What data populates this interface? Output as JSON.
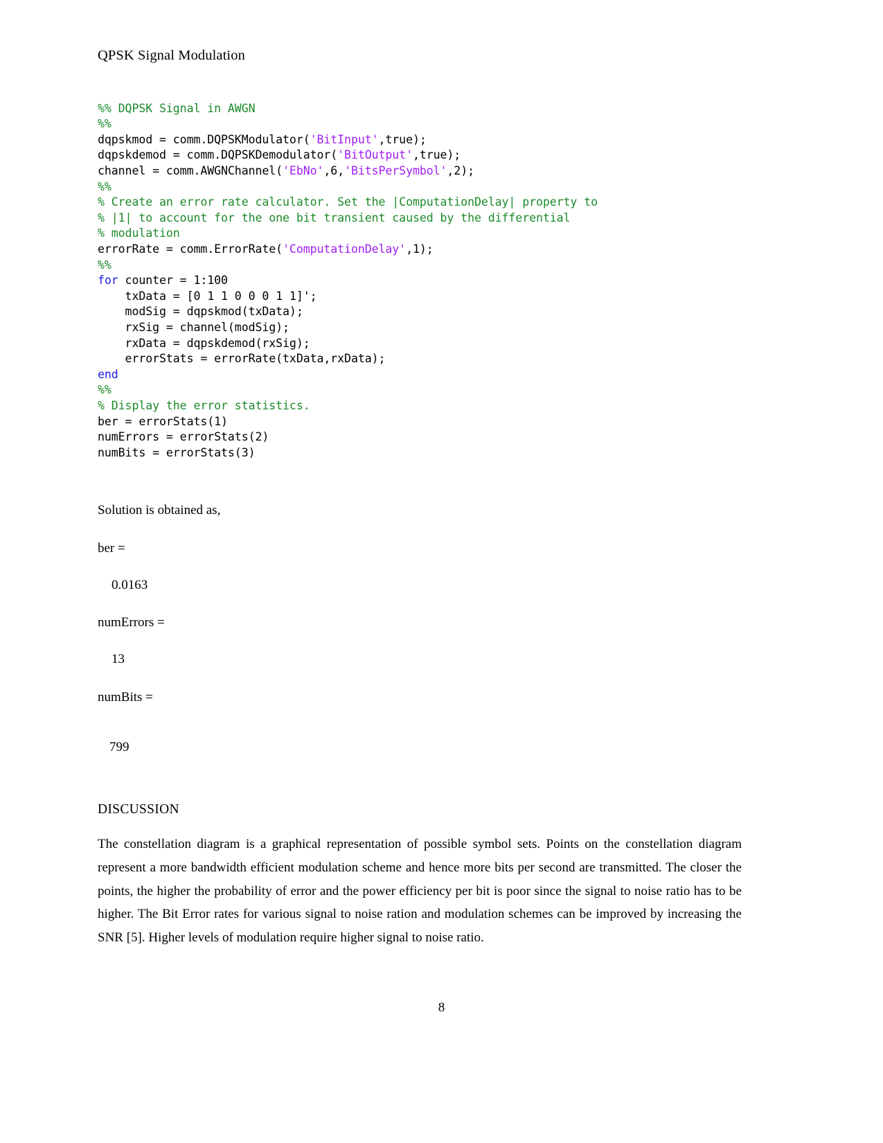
{
  "document": {
    "title": "QPSK Signal Modulation",
    "page_number": "8"
  },
  "code": {
    "language": "matlab",
    "lines": [
      [
        {
          "t": "comment",
          "s": "%% DQPSK Signal in AWGN"
        }
      ],
      [
        {
          "t": "comment",
          "s": "%%"
        }
      ],
      [
        {
          "t": "plain",
          "s": "dqpskmod = comm.DQPSKModulator("
        },
        {
          "t": "string",
          "s": "'BitInput'"
        },
        {
          "t": "plain",
          "s": ",true);"
        }
      ],
      [
        {
          "t": "plain",
          "s": "dqpskdemod = comm.DQPSKDemodulator("
        },
        {
          "t": "string",
          "s": "'BitOutput'"
        },
        {
          "t": "plain",
          "s": ",true);"
        }
      ],
      [
        {
          "t": "plain",
          "s": "channel = comm.AWGNChannel("
        },
        {
          "t": "string",
          "s": "'EbNo'"
        },
        {
          "t": "plain",
          "s": ",6,"
        },
        {
          "t": "string",
          "s": "'BitsPerSymbol'"
        },
        {
          "t": "plain",
          "s": ",2);"
        }
      ],
      [
        {
          "t": "comment",
          "s": "%%"
        }
      ],
      [
        {
          "t": "comment",
          "s": "% Create an error rate calculator. Set the |ComputationDelay| property to"
        }
      ],
      [
        {
          "t": "comment",
          "s": "% |1| to account for the one bit transient caused by the differential"
        }
      ],
      [
        {
          "t": "comment",
          "s": "% modulation"
        }
      ],
      [
        {
          "t": "plain",
          "s": "errorRate = comm.ErrorRate("
        },
        {
          "t": "string",
          "s": "'ComputationDelay'"
        },
        {
          "t": "plain",
          "s": ",1);"
        }
      ],
      [
        {
          "t": "comment",
          "s": "%%"
        }
      ],
      [
        {
          "t": "keyword",
          "s": "for"
        },
        {
          "t": "plain",
          "s": " counter = 1:100"
        }
      ],
      [
        {
          "t": "plain",
          "s": "    txData = [0 1 1 0 0 0 1 1]';"
        }
      ],
      [
        {
          "t": "plain",
          "s": "    modSig = dqpskmod(txData);"
        }
      ],
      [
        {
          "t": "plain",
          "s": "    rxSig = channel(modSig);"
        }
      ],
      [
        {
          "t": "plain",
          "s": "    rxData = dqpskdemod(rxSig);"
        }
      ],
      [
        {
          "t": "plain",
          "s": "    errorStats = errorRate(txData,rxData);"
        }
      ],
      [
        {
          "t": "keyword",
          "s": "end"
        }
      ],
      [
        {
          "t": "comment",
          "s": "%%"
        }
      ],
      [
        {
          "t": "comment",
          "s": "% Display the error statistics."
        }
      ],
      [
        {
          "t": "plain",
          "s": "ber = errorStats(1)"
        }
      ],
      [
        {
          "t": "plain",
          "s": "numErrors = errorStats(2)"
        }
      ],
      [
        {
          "t": "plain",
          "s": "numBits = errorStats(3)"
        }
      ]
    ]
  },
  "results": {
    "lead_in": "Solution is obtained as,",
    "items": [
      {
        "label": "ber =",
        "value": "0.0163"
      },
      {
        "label": "numErrors =",
        "value": "13"
      },
      {
        "label": "numBits =",
        "value": "799"
      }
    ]
  },
  "discussion": {
    "heading": "DISCUSSION",
    "paragraph": "The constellation diagram is a graphical representation of possible symbol sets. Points on the constellation diagram represent a more bandwidth efficient modulation scheme and hence more bits per second are transmitted. The closer the points, the higher the probability of error and the power efficiency per bit is poor since the signal to noise ratio has to be higher. The Bit Error rates for various signal to noise ration and modulation schemes can be improved by increasing the SNR [5]. Higher levels of modulation require higher signal to noise ratio."
  },
  "colors": {
    "comment": "#1d8a2b",
    "string": "#a020f0",
    "keyword": "#2020e0",
    "text": "#000000",
    "background": "#ffffff"
  }
}
